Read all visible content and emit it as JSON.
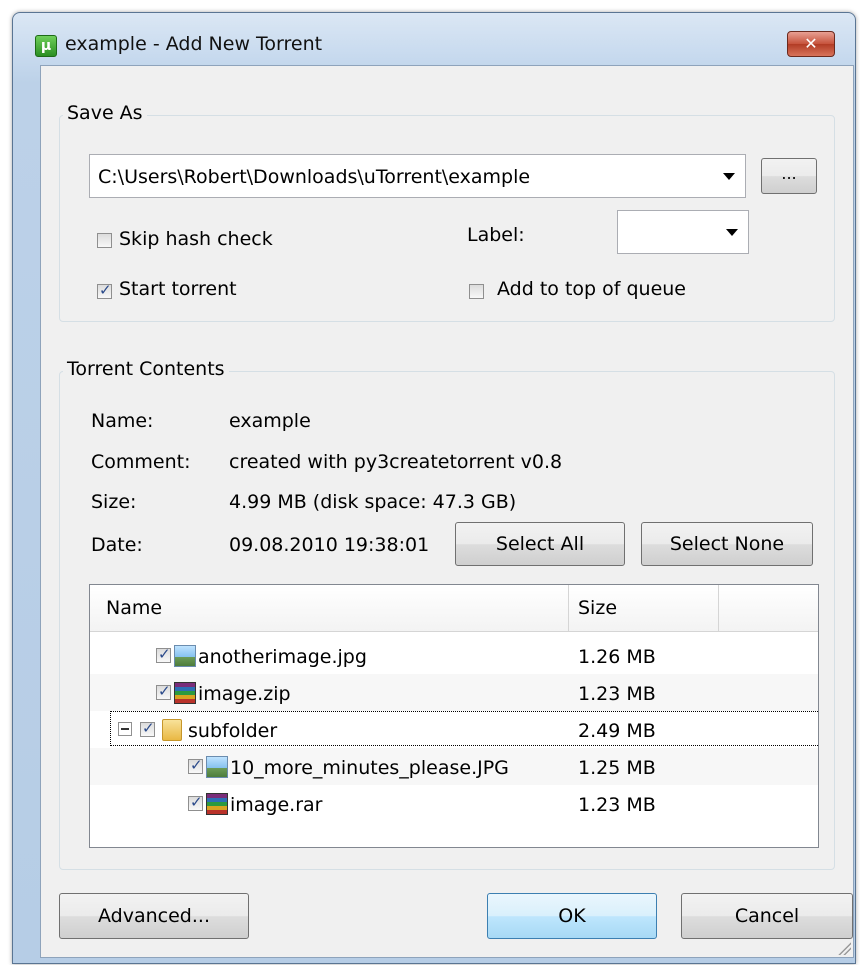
{
  "window": {
    "title": "example - Add New Torrent",
    "app_icon": "µ",
    "close_label": "✕"
  },
  "save_as": {
    "group_title": "Save As",
    "path": "C:\\Users\\Robert\\Downloads\\uTorrent\\example",
    "browse_label": "...",
    "skip_hash_check": {
      "label": "Skip hash check",
      "checked": false
    },
    "label_caption": "Label:",
    "label_value": "",
    "start_torrent": {
      "label": "Start torrent",
      "checked": true
    },
    "add_to_top": {
      "label": "Add to top of queue",
      "checked": false
    }
  },
  "contents": {
    "group_title": "Torrent Contents",
    "name_label": "Name:",
    "name_value": "example",
    "comment_label": "Comment:",
    "comment_value": "created with py3createtorrent v0.8",
    "size_label": "Size:",
    "size_value": "4.99 MB (disk space: 47.3 GB)",
    "date_label": "Date:",
    "date_value": "09.08.2010 19:38:01",
    "select_all": "Select All",
    "select_none": "Select None",
    "columns": {
      "name": "Name",
      "size": "Size"
    },
    "files": [
      {
        "name": "anotherimage.jpg",
        "size": "1.26 MB",
        "icon": "image-file-icon",
        "checked": true
      },
      {
        "name": "image.zip",
        "size": "1.23 MB",
        "icon": "archive-file-icon",
        "checked": true
      },
      {
        "name": "subfolder",
        "size": "2.49 MB",
        "icon": "folder-icon",
        "checked": true,
        "expanded": true
      },
      {
        "name": "10_more_minutes_please.JPG",
        "size": "1.25 MB",
        "icon": "image-file-icon",
        "checked": true
      },
      {
        "name": "image.rar",
        "size": "1.23 MB",
        "icon": "archive-file-icon",
        "checked": true
      }
    ]
  },
  "footer": {
    "advanced": "Advanced...",
    "ok": "OK",
    "cancel": "Cancel"
  },
  "colors": {
    "frame": "#bcd1e8",
    "client": "#f0f0f0",
    "close": "#c6523b",
    "default_button": "#bee6fd"
  }
}
